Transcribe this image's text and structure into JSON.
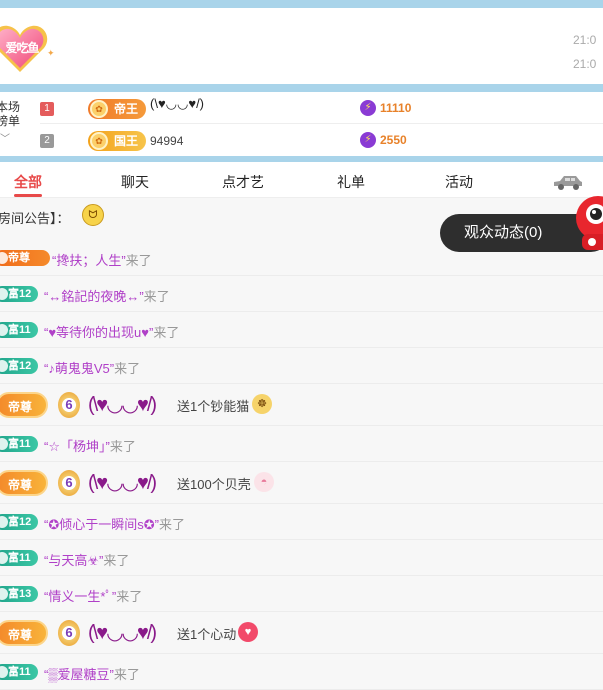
{
  "banner": {
    "heart_label": "爱吃鱼",
    "times": [
      "21:0",
      "21:0"
    ]
  },
  "rank": {
    "title": "本场榜单",
    "rows": [
      {
        "num": "1",
        "badge": "帝王",
        "name": "(\\♥◡◡♥/)",
        "score": "11110"
      },
      {
        "num": "2",
        "badge": "国王",
        "name": "94994",
        "score": "2550"
      }
    ]
  },
  "tabs": [
    "全部",
    "聊天",
    "点才艺",
    "礼单",
    "活动"
  ],
  "notice": "房间公告】：",
  "audience_button": "观众动态(0)",
  "messages": [
    {
      "type": "enter",
      "badge": "帝尊",
      "style": "orange",
      "name": "“搀扶；人生”",
      "suffix": "来了"
    },
    {
      "type": "enter",
      "badge": "富12",
      "style": "teal",
      "name": "“↔銘記的夜晚↔”",
      "suffix": "来了"
    },
    {
      "type": "enter",
      "badge": "富11",
      "style": "teal",
      "name": "“♥等待你的出现u♥”",
      "suffix": "来了"
    },
    {
      "type": "enter",
      "badge": "富12",
      "style": "teal",
      "name": "“♪萌鬼鬼V5”",
      "suffix": "来了"
    },
    {
      "type": "gift",
      "badge": "帝尊",
      "level": "6",
      "kaomoji": "(\\♥◡◡♥/)",
      "gift": "送1个钞能猫"
    },
    {
      "type": "enter",
      "badge": "富11",
      "style": "teal",
      "name": "“☆「杨坤」”",
      "suffix": "来了"
    },
    {
      "type": "gift",
      "badge": "帝尊",
      "level": "6",
      "kaomoji": "(\\♥◡◡♥/)",
      "gift": "送100个贝壳"
    },
    {
      "type": "enter",
      "badge": "富12",
      "style": "teal",
      "name": "“✪倾心于一瞬间s✪”",
      "suffix": "来了"
    },
    {
      "type": "enter",
      "badge": "富11",
      "style": "teal",
      "name": "“与天高☣”",
      "suffix": "来了"
    },
    {
      "type": "enter",
      "badge": "富13",
      "style": "teal",
      "name": "“情义一生*ﾟ”",
      "suffix": "来了"
    },
    {
      "type": "gift",
      "badge": "帝尊",
      "level": "6",
      "kaomoji": "(\\♥◡◡♥/)",
      "gift": "送1个心动"
    },
    {
      "type": "enter",
      "badge": "富11",
      "style": "teal",
      "name": "“▒爱屋糖豆”",
      "suffix": "来了"
    }
  ],
  "colors": {
    "accent": "#e84a4a",
    "banner_blue": "#a9d4ea",
    "name_purple": "#b040c8",
    "score_orange": "#e8822a"
  }
}
